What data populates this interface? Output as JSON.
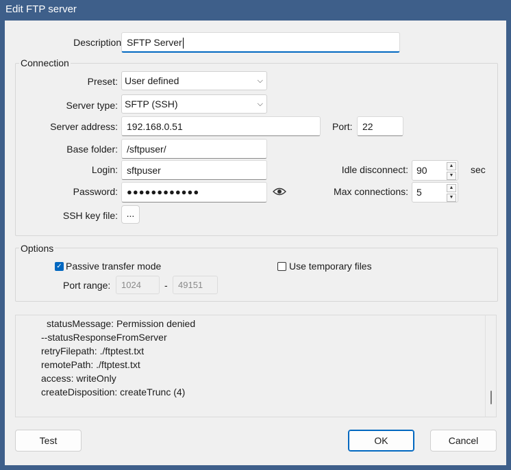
{
  "window": {
    "title": "Edit FTP server"
  },
  "description": {
    "label": "Description:",
    "value": "SFTP Server"
  },
  "connection": {
    "group_label": "Connection",
    "preset": {
      "label": "Preset:",
      "value": "User defined"
    },
    "server_type": {
      "label": "Server type:",
      "value": "SFTP (SSH)"
    },
    "server_address": {
      "label": "Server address:",
      "value": "192.168.0.51"
    },
    "port": {
      "label": "Port:",
      "value": "22"
    },
    "base_folder": {
      "label": "Base folder:",
      "value": "/sftpuser/"
    },
    "login": {
      "label": "Login:",
      "value": "sftpuser"
    },
    "password": {
      "label": "Password:",
      "value": "●●●●●●●●●●●●"
    },
    "ssh_key_file": {
      "label": "SSH key file:",
      "button": "..."
    },
    "idle_disconnect": {
      "label": "Idle disconnect:",
      "value": "90",
      "unit": "sec"
    },
    "max_connections": {
      "label": "Max connections:",
      "value": "5"
    }
  },
  "options": {
    "group_label": "Options",
    "passive": {
      "label": "Passive transfer mode",
      "checked": true
    },
    "temp_files": {
      "label": "Use temporary files",
      "checked": false
    },
    "port_range": {
      "label": "Port range:",
      "from": "1024",
      "sep": "-",
      "to": "49151"
    }
  },
  "log": {
    "lines": [
      "statusMessage: Permission denied",
      "--statusResponseFromServer",
      "retryFilepath: ./ftptest.txt",
      "remotePath: ./ftptest.txt",
      "access: writeOnly",
      "createDisposition: createTrunc (4)"
    ]
  },
  "buttons": {
    "test": "Test",
    "ok": "OK",
    "cancel": "Cancel"
  },
  "icons": {
    "password_reveal": "eye-icon",
    "dropdown": "chevron-down-icon",
    "spin_up": "arrow-up-icon",
    "spin_down": "arrow-down-icon",
    "check": "checkmark-icon"
  },
  "colors": {
    "titlebar": "#3e5f8a",
    "accent": "#0067c0",
    "dialog_bg": "#f0f0f0"
  }
}
